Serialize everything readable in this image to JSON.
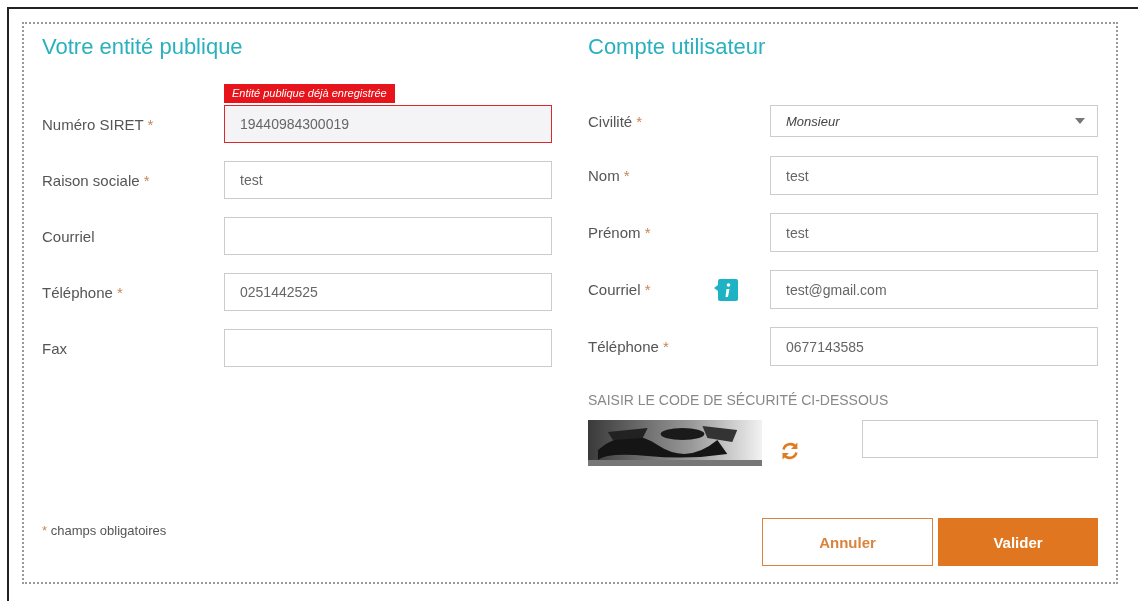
{
  "left_section": {
    "title": "Votre entité publique",
    "fields": [
      {
        "label": "Numéro SIRET",
        "mark": "*",
        "value": "19440984300019",
        "error": "Entité publique déjà enregistrée"
      },
      {
        "label": "Raison sociale",
        "mark": "*",
        "value": "test"
      },
      {
        "label": "Courriel"
      },
      {
        "label": "Téléphone",
        "mark": "*",
        "value": "0251442525"
      },
      {
        "label": "Fax"
      }
    ],
    "footnote": {
      "mark": "*",
      "text": "champs obligatoires"
    }
  },
  "right_section": {
    "title": "Compte utilisateur",
    "fields": [
      {
        "kind": "select",
        "label": "Civilité",
        "mark": "*",
        "value": "Monsieur"
      },
      {
        "kind": "text",
        "label": "Nom",
        "mark": "*",
        "value": "test"
      },
      {
        "kind": "text",
        "label": "Prénom",
        "mark": "*",
        "value": "test"
      },
      {
        "kind": "text",
        "label": "Courriel",
        "mark": "*",
        "value": "test@gmail.com",
        "info": true
      },
      {
        "kind": "text",
        "label": "Téléphone",
        "mark": "*",
        "value": "0677143585"
      }
    ],
    "captcha": {
      "heading": "SAISIR LE CODE DE SÉCURITÉ CI-DESSOUS"
    },
    "buttons": [
      {
        "label": "Annuler",
        "kind": "secondary"
      },
      {
        "label": "Valider",
        "kind": "primary"
      }
    ]
  }
}
